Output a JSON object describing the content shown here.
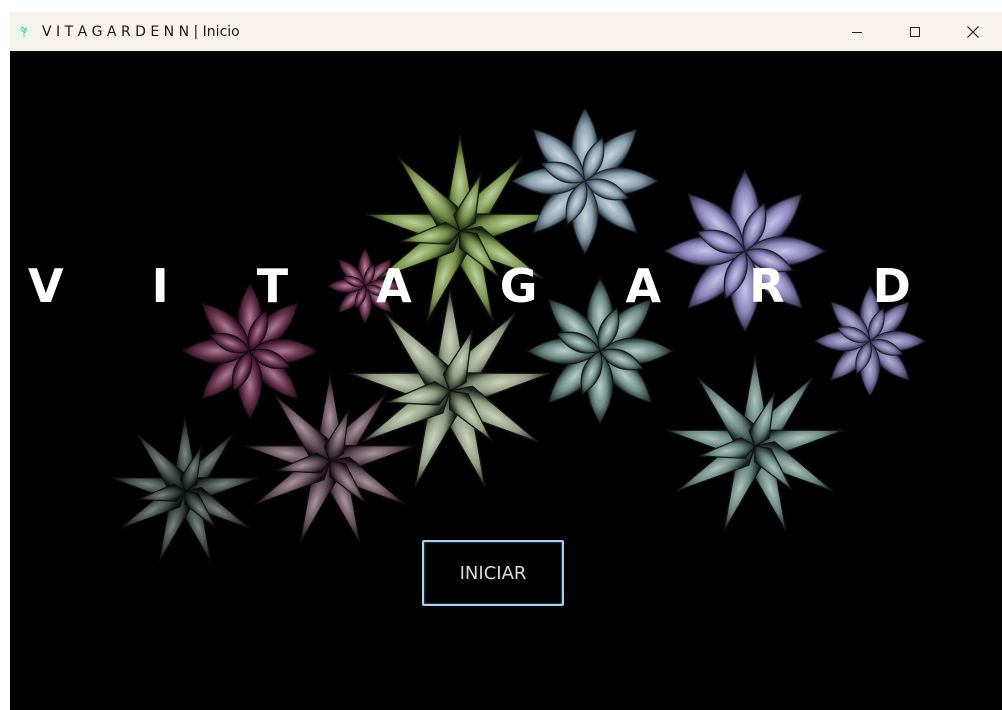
{
  "window": {
    "title": "V I T A G A R D E N N | Inicio",
    "controls": {
      "minimize_icon": "minimize-icon",
      "maximize_icon": "maximize-icon",
      "close_icon": "close-icon"
    }
  },
  "main": {
    "brand_title": "V I T A G A R D E N N",
    "start_button_label": "INICIAR",
    "background": "succulents-photo"
  },
  "colors": {
    "titlebar_bg": "#f7f3ec",
    "content_bg": "#000000",
    "button_border": "#a9d2f2",
    "brand_text": "#ffffff"
  }
}
